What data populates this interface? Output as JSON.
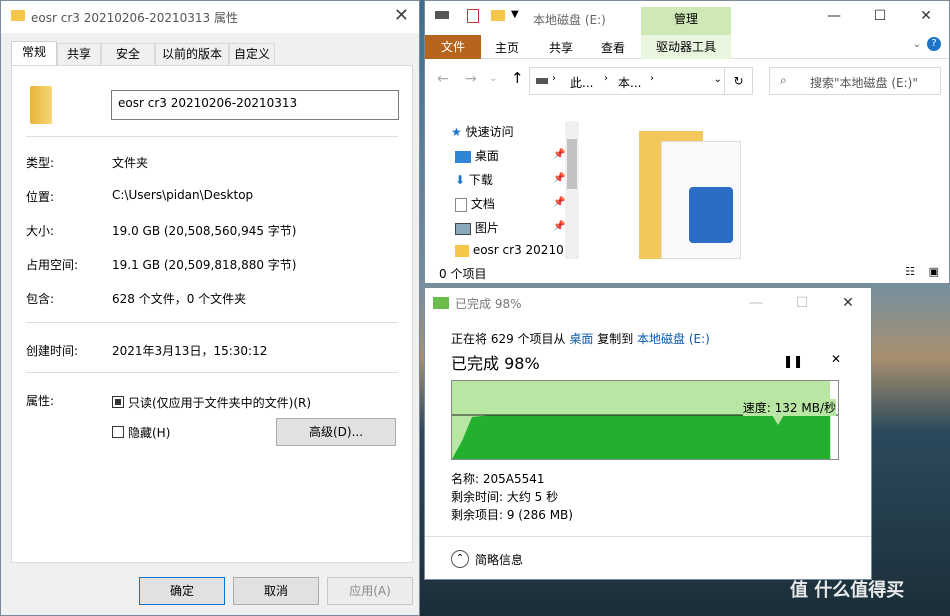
{
  "props": {
    "title": "eosr cr3 20210206-20210313 属性",
    "tabs": [
      "常规",
      "共享",
      "安全",
      "以前的版本",
      "自定义"
    ],
    "name_value": "eosr cr3 20210206-20210313",
    "rows": [
      {
        "label": "类型:",
        "value": "文件夹"
      },
      {
        "label": "位置:",
        "value": "C:\\Users\\pidan\\Desktop"
      },
      {
        "label": "大小:",
        "value": "19.0 GB (20,508,560,945 字节)"
      },
      {
        "label": "占用空间:",
        "value": "19.1 GB (20,509,818,880 字节)"
      },
      {
        "label": "包含:",
        "value": "628 个文件，0 个文件夹"
      },
      {
        "label": "创建时间:",
        "value": "2021年3月13日，15:30:12"
      }
    ],
    "attr_label": "属性:",
    "readonly": "只读(仅应用于文件夹中的文件)(R)",
    "hidden": "隐藏(H)",
    "advanced": "高级(D)...",
    "ok": "确定",
    "cancel": "取消",
    "apply": "应用(A)"
  },
  "explorer": {
    "title": "本地磁盘 (E:)",
    "manage": "管理",
    "ribbon_tabs": [
      "文件",
      "主页",
      "共享",
      "查看",
      "驱动器工具"
    ],
    "crumbs": [
      "此...",
      "本..."
    ],
    "search_placeholder": "搜索\"本地磁盘 (E:)\"",
    "nav": [
      "快速访问",
      "桌面",
      "下载",
      "文档",
      "图片",
      "eosr cr3 20210"
    ],
    "status": "0 个项目"
  },
  "copy": {
    "title": "已完成 98%",
    "line1_pre": "正在将 629 个项目从 ",
    "from": "桌面",
    "mid": " 复制到 ",
    "to": "本地磁盘 (E:)",
    "percent_text": "已完成 98%",
    "progress": 0.98,
    "speed": "速度: 132 MB/秒",
    "name": "名称: 205A5541",
    "time_left": "剩余时间: 大约 5 秒",
    "items_left": "剩余项目: 9 (286 MB)",
    "less": "简略信息"
  },
  "watermark": "值 什么值得买"
}
